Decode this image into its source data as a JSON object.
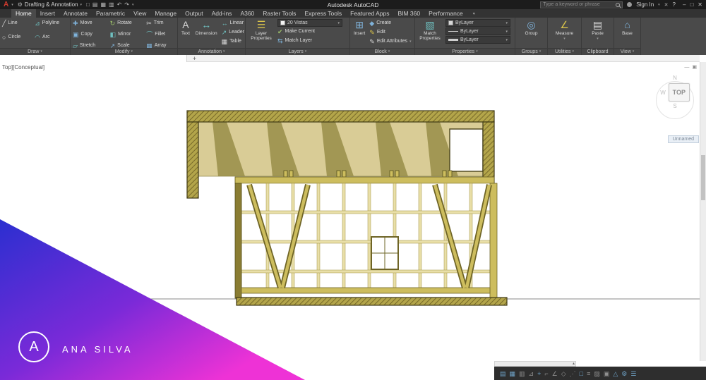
{
  "title_bar": {
    "app_title": "Autodesk AutoCAD",
    "workspace": "Drafting & Annotation",
    "workspace_icon_glyph": "⚙",
    "search_placeholder": "Type a keyword or phrase",
    "sign_in_label": "Sign In",
    "help_label": "?",
    "exchange_glyph": "✕",
    "logo_letter": "A",
    "qat_icons": [
      {
        "name": "new-file-icon",
        "glyph": "□"
      },
      {
        "name": "open-file-icon",
        "glyph": "▤"
      },
      {
        "name": "save-file-icon",
        "glyph": "▦"
      },
      {
        "name": "plot-icon",
        "glyph": "▥"
      },
      {
        "name": "undo-icon",
        "glyph": "↶"
      },
      {
        "name": "redo-icon",
        "glyph": "↷"
      }
    ],
    "window_controls": {
      "minimize": "–",
      "restore": "□",
      "close": "✕"
    }
  },
  "ui": {
    "chevron_down": "▾"
  },
  "ribbon": {
    "active_tab": "Home",
    "tabs": [
      "Home",
      "Insert",
      "Annotate",
      "Parametric",
      "View",
      "Manage",
      "Output",
      "Add-ins",
      "A360",
      "Raster Tools",
      "Express Tools",
      "Featured Apps",
      "BIM 360",
      "Performance"
    ]
  },
  "panels": {
    "draw": {
      "label": "Draw",
      "tools": [
        {
          "label": "Line",
          "glyph": "╱"
        },
        {
          "label": "Polyline",
          "glyph": "⊿"
        },
        {
          "label": "Circle",
          "glyph": "○"
        },
        {
          "label": "Arc",
          "glyph": "◠"
        }
      ]
    },
    "modify": {
      "label": "Modify",
      "tools": [
        {
          "label": "Move",
          "glyph": "✚"
        },
        {
          "label": "Copy",
          "glyph": "▣"
        },
        {
          "label": "Stretch",
          "glyph": "▱"
        },
        {
          "label": "Rotate",
          "glyph": "↻"
        },
        {
          "label": "Mirror",
          "glyph": "◧"
        },
        {
          "label": "Scale",
          "glyph": "↗"
        },
        {
          "label": "Trim",
          "glyph": "✂"
        },
        {
          "label": "Fillet",
          "glyph": "⌒"
        },
        {
          "label": "Array",
          "glyph": "▦"
        }
      ]
    },
    "annotation": {
      "label": "Annotation",
      "big": [
        {
          "label": "Text",
          "glyph": "A"
        },
        {
          "label": "Dimension",
          "glyph": "↔"
        }
      ],
      "small": [
        {
          "label": "Linear",
          "glyph": "↔"
        },
        {
          "label": "Leader",
          "glyph": "↗"
        },
        {
          "label": "Table",
          "glyph": "▦"
        }
      ]
    },
    "layers": {
      "label": "Layers",
      "big_label": "Layer Properties",
      "big_glyph": "☰",
      "current_layer": "20 Vistas",
      "tools": [
        {
          "label": "Make Current",
          "glyph": "✔"
        },
        {
          "label": "Match Layer",
          "glyph": "⇆"
        }
      ]
    },
    "block": {
      "label": "Block",
      "big_label": "Insert",
      "big_glyph": "⊞",
      "tools": [
        {
          "label": "Create",
          "glyph": "◆"
        },
        {
          "label": "Edit",
          "glyph": "✎"
        },
        {
          "label": "Edit Attributes",
          "glyph": "✎"
        }
      ]
    },
    "properties": {
      "label": "Properties",
      "big_label": "Match Properties",
      "big_glyph": "▧",
      "dropdowns": [
        {
          "value": "ByLayer"
        },
        {
          "value": "ByLayer"
        },
        {
          "value": "ByLayer"
        }
      ]
    },
    "groups": {
      "label": "Groups",
      "big_label": "Group",
      "big_glyph": "◎"
    },
    "utilities": {
      "label": "Utilities",
      "big_label": "Measure",
      "big_glyph": "∠"
    },
    "clipboard": {
      "label": "Clipboard",
      "big_label": "Paste",
      "big_glyph": "▤"
    },
    "view": {
      "label": "View",
      "big_label": "Base",
      "big_glyph": "⌂"
    }
  },
  "viewport": {
    "view_label": "Top][Conceptual]",
    "new_tab_button": "+",
    "viewcube": {
      "north": "N",
      "west": "W",
      "south": "S",
      "top_face": "TOP"
    },
    "view_name_badge": "Unnamed",
    "window_controls": {
      "minimize": "—",
      "restore": "▣"
    }
  },
  "watermark": {
    "brand": "ANA SILVA",
    "logo_letter": "A"
  },
  "statusbar": {
    "icons": [
      {
        "name": "model-space-icon",
        "glyph": "▤"
      },
      {
        "name": "grid-icon",
        "glyph": "▦"
      },
      {
        "name": "snap-icon",
        "glyph": "▥"
      },
      {
        "name": "infer-constraints-icon",
        "glyph": "⊿"
      },
      {
        "name": "dynamic-input-icon",
        "glyph": "+"
      },
      {
        "name": "ortho-icon",
        "glyph": "⌐"
      },
      {
        "name": "polar-tracking-icon",
        "glyph": "∠"
      },
      {
        "name": "isodraft-icon",
        "glyph": "◇"
      },
      {
        "name": "osnap-tracking-icon",
        "glyph": "⋰"
      },
      {
        "name": "osnap-icon",
        "glyph": "□"
      },
      {
        "name": "lineweight-icon",
        "glyph": "≡"
      },
      {
        "name": "transparency-icon",
        "glyph": "▨"
      },
      {
        "name": "selection-cycling-icon",
        "glyph": "▣"
      },
      {
        "name": "annotation-scale-icon",
        "glyph": "△"
      },
      {
        "name": "workspace-switch-icon",
        "glyph": "⚙"
      },
      {
        "name": "customize-icon",
        "glyph": "☰"
      }
    ]
  },
  "colors": {
    "watermark_blue": "#2b2fd0",
    "watermark_magenta": "#e62ad4",
    "wood_olive": "#b3a54a",
    "wood_dark": "#6e6426",
    "ceiling_tan": "#d9cc96"
  }
}
